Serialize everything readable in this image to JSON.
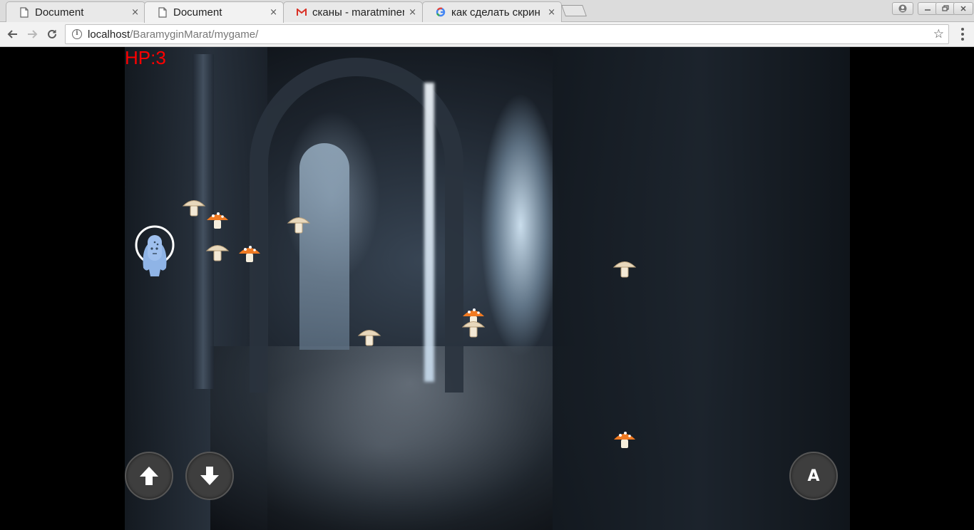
{
  "browser": {
    "tabs": [
      {
        "title": "Document",
        "close": "×",
        "favicon": "document-icon",
        "active": false
      },
      {
        "title": "Document",
        "close": "×",
        "favicon": "document-icon",
        "active": true
      },
      {
        "title": "сканы - maratminer",
        "close": "×",
        "favicon": "gmail-icon",
        "active": false
      },
      {
        "title": "как сделать скрин",
        "close": "×",
        "favicon": "google-icon",
        "active": false
      }
    ],
    "url_host": "localhost",
    "url_path": "/BaramyginMarat/mygame/"
  },
  "game": {
    "hp_text": "HP:3",
    "hp_color": "#ff0000",
    "controls": {
      "up_icon": "arrow-up-icon",
      "down_icon": "arrow-down-icon",
      "action_label": "A"
    },
    "mushrooms": [
      {
        "kind": "beige"
      },
      {
        "kind": "orange"
      },
      {
        "kind": "beige"
      },
      {
        "kind": "beige"
      },
      {
        "kind": "orange"
      },
      {
        "kind": "beige"
      },
      {
        "kind": "orange"
      },
      {
        "kind": "beige"
      },
      {
        "kind": "beige"
      },
      {
        "kind": "orange"
      }
    ]
  }
}
